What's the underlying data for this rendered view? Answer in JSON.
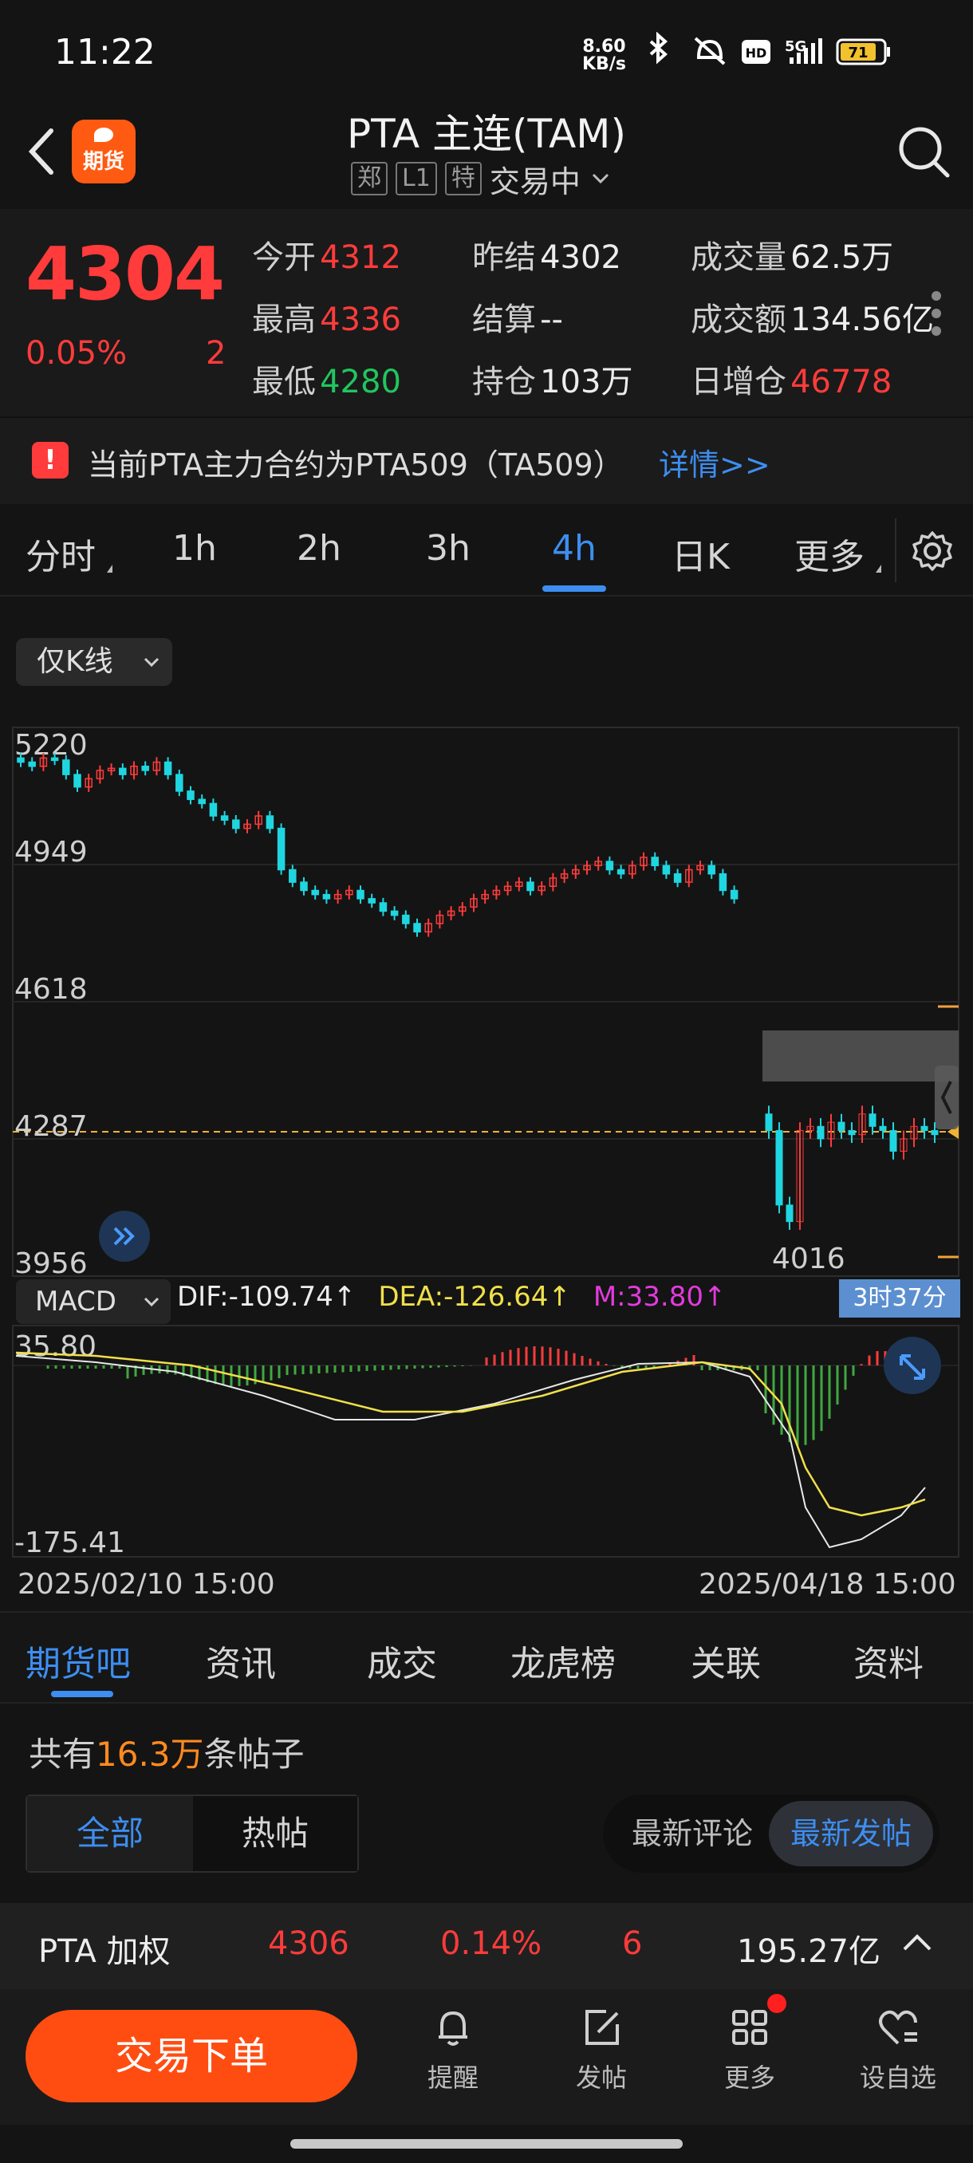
{
  "status_bar": {
    "time": "11:22",
    "net_speed_value": "8.60",
    "net_speed_unit": "KB/s",
    "network": "5G",
    "battery": "71"
  },
  "header": {
    "logo_text": "期货",
    "title": "PTA 主连(TAM)",
    "tags": [
      "郑",
      "L1",
      "特"
    ],
    "trade_status": "交易中"
  },
  "quote": {
    "price": "4304",
    "change_pct": "0.05%",
    "change": "2",
    "fields": [
      {
        "label": "今开",
        "value": "4312",
        "color": "red"
      },
      {
        "label": "昨结",
        "value": "4302",
        "color": "white"
      },
      {
        "label": "成交量",
        "value": "62.5万",
        "color": "white"
      },
      {
        "label": "最高",
        "value": "4336",
        "color": "red"
      },
      {
        "label": "结算",
        "value": "--",
        "color": "white"
      },
      {
        "label": "成交额",
        "value": "134.56亿",
        "color": "white"
      },
      {
        "label": "最低",
        "value": "4280",
        "color": "green"
      },
      {
        "label": "持仓",
        "value": "103万",
        "color": "white"
      },
      {
        "label": "日增仓",
        "value": "46778",
        "color": "red"
      }
    ]
  },
  "notice": {
    "icon": "!",
    "text": "当前PTA主力合约为PTA509（TA509）",
    "link": "详情>>"
  },
  "period_tabs": [
    "分时",
    "1h",
    "2h",
    "3h",
    "4h",
    "日K",
    "更多"
  ],
  "active_period": "4h",
  "chart": {
    "mode_label": "仅K线",
    "y_labels": [
      "5220",
      "4949",
      "4618",
      "4287",
      "3956"
    ],
    "low_marker": "4016",
    "macd_label": "MACD",
    "dif": "DIF:-109.74↑",
    "dea": "DEA:-126.64↑",
    "m": "M:33.80↑",
    "countdown": "3时37分",
    "macd_y_top": "35.80",
    "macd_y_bottom": "-175.41",
    "date_start": "2025/02/10 15:00",
    "date_end": "2025/04/18 15:00",
    "colors": {
      "up": "#ff3b3b",
      "down": "#1fd6e0",
      "dif": "#e8e8e8",
      "dea": "#f0e04a"
    }
  },
  "section_tabs": [
    "期货吧",
    "资讯",
    "成交",
    "龙虎榜",
    "关联",
    "资料"
  ],
  "forum": {
    "prefix": "共有",
    "count": "16.3万",
    "suffix": "条帖子",
    "filter_all": "全部",
    "filter_hot": "热帖",
    "sort_comment": "最新评论",
    "sort_new": "最新发帖"
  },
  "weighted": {
    "name": "PTA 加权",
    "price": "4306",
    "pct": "0.14%",
    "change": "6",
    "amount": "195.27亿"
  },
  "bottom_nav": {
    "trade": "交易下单",
    "items": [
      {
        "label": "提醒",
        "icon": "bell-icon"
      },
      {
        "label": "发帖",
        "icon": "edit-icon"
      },
      {
        "label": "更多",
        "icon": "grid-icon"
      },
      {
        "label": "设自选",
        "icon": "heart-add-icon"
      }
    ]
  }
}
